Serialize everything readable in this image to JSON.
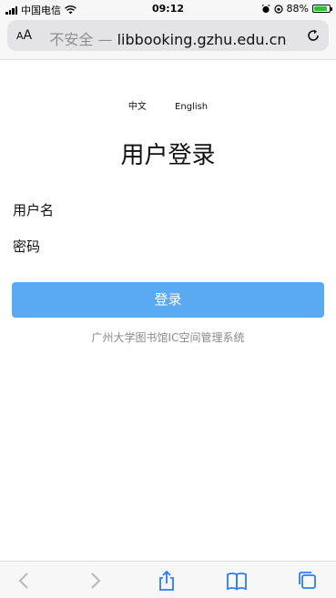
{
  "status_bar": {
    "carrier": "中国电信",
    "time": "09:12",
    "battery_percent": "88%",
    "battery_level": 0.88
  },
  "browser": {
    "text_size_button": "AA",
    "insecure_label": "不安全",
    "separator": "—",
    "host": "libbooking.gzhu.edu.cn"
  },
  "page": {
    "language_options": [
      "中文",
      "English"
    ],
    "title": "用户登录",
    "username_label": "用户名",
    "password_label": "密码",
    "login_button": "登录",
    "system_name": "广州大学图书馆IC空间管理系统"
  },
  "colors": {
    "login_button": "#5aaaf3",
    "system_name_text": "#8a8a8a",
    "toolbar_icon_active": "#2f7cf6",
    "toolbar_icon_disabled": "#b8b8bd"
  },
  "toolbar": {
    "icons": [
      "back-icon",
      "forward-icon",
      "share-icon",
      "bookmarks-icon",
      "tabs-icon"
    ]
  }
}
